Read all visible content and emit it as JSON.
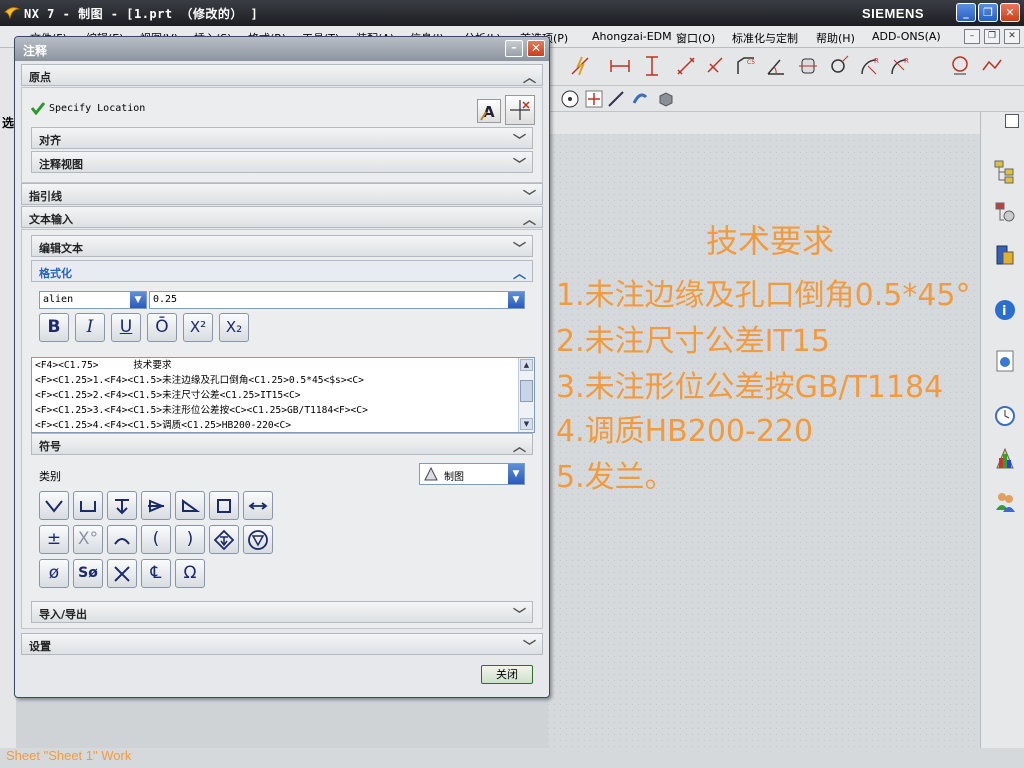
{
  "window": {
    "title": "NX 7 - 制图 - [1.prt （修改的） ]",
    "brand": "SIEMENS",
    "min_label": "_",
    "max_label": "❐",
    "close_label": "✕"
  },
  "menu": {
    "items": [
      "文件(F)",
      "编辑(E)",
      "视图(V)",
      "插入(S)",
      "格式(R)",
      "工具(T)",
      "装配(A)",
      "信息(I)",
      "分析(L)",
      "首选项(P)",
      "Ahongzai-EDM",
      "窗口(O)",
      "标准化与定制",
      "帮助(H)",
      "ADD-ONS(A)"
    ]
  },
  "left_labels": {
    "select": "选"
  },
  "dialog": {
    "title": "注释",
    "sections": {
      "origin": "原点",
      "align": "对齐",
      "annotation_view": "注释视图",
      "leader": "指引线",
      "text_input": "文本输入",
      "edit_text": "编辑文本",
      "format": "格式化",
      "symbols": "符号",
      "import_export": "导入/导出",
      "settings": "设置"
    },
    "specify_location": "Specify Location",
    "font": "alien",
    "size": "0.25",
    "format_buttons": [
      "B",
      "I",
      "U",
      "Ō",
      "X²",
      "X₂"
    ],
    "text_lines": [
      "<F4><C1.75>      技术要求",
      "<F><C1.25>1.<F4><C1.5>未注边缘及孔口倒角<C1.25>0.5*45<$s><C>",
      "<F><C1.25>2.<F4><C1.5>未注尺寸公差<C1.25>IT15<C>",
      "<F><C1.25>3.<F4><C1.5>未注形位公差按<C><C1.25>GB/T1184<F><C>",
      "<F><C1.25>4.<F4><C1.5>调质<C1.25>HB200-220<C>"
    ],
    "category_label": "类别",
    "category_value": "制图",
    "close_button": "关闭"
  },
  "drawing": {
    "title": "技术要求",
    "lines": [
      "1.未注边缘及孔口倒角0.5*45°",
      "2.未注尺寸公差IT15",
      "3.未注形位公差按GB/T1184",
      "4.调质HB200-220",
      "5.发兰。"
    ]
  },
  "status": {
    "text": "Sheet \"Sheet 1\" Work"
  },
  "colors": {
    "annotation": "#f29a3c",
    "accent_blue": "#2563c0"
  }
}
